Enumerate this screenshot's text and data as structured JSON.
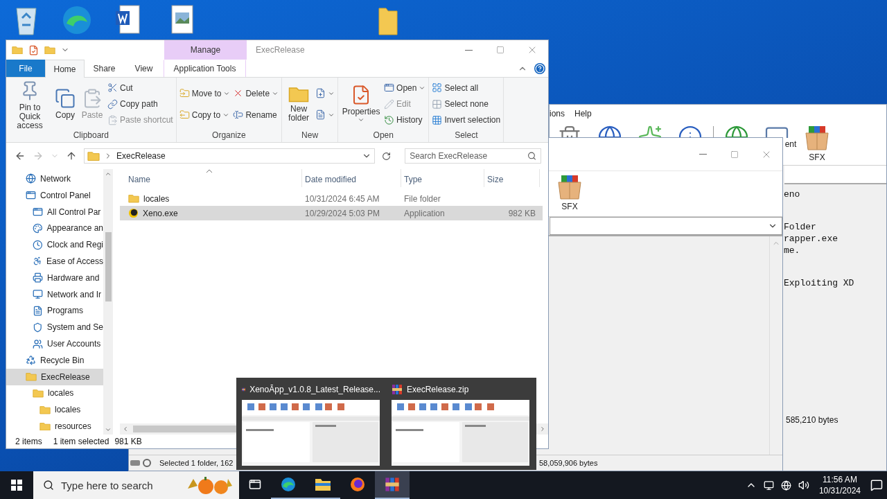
{
  "back_archiver": {
    "menu": [
      "ions",
      "Help"
    ],
    "toolbar_labels": [
      "ent",
      "SFX"
    ],
    "info_paragraphs": [
      [
        "eno"
      ],
      [
        "Folder",
        "rapper.exe",
        "me."
      ],
      [
        "Exploiting XD"
      ]
    ],
    "status": "585,210 bytes"
  },
  "front_archiver": {
    "toolbar_labels": [
      "SFX"
    ],
    "status_left": "Selected 1 folder, 162",
    "status_right": "58,059,906 bytes"
  },
  "explorer": {
    "title": "ExecRelease",
    "context_header": "Manage",
    "tabs": [
      {
        "label": "File",
        "kind": "file",
        "selected": false
      },
      {
        "label": "Home",
        "kind": "tab",
        "selected": true
      },
      {
        "label": "Share",
        "kind": "tab",
        "selected": false
      },
      {
        "label": "View",
        "kind": "tab",
        "selected": false
      },
      {
        "label": "Application Tools",
        "kind": "context",
        "selected": false
      }
    ],
    "ribbon": [
      {
        "name": "Clipboard",
        "columns": [
          [
            {
              "label": "Pin to Quick access",
              "kind": "large",
              "disabled": false
            }
          ],
          [
            {
              "label": "Copy",
              "kind": "large",
              "disabled": false
            }
          ],
          [
            {
              "label": "Paste",
              "kind": "large",
              "disabled": true
            }
          ],
          [
            {
              "label": "Cut",
              "kind": "small",
              "disabled": false
            },
            {
              "label": "Copy path",
              "kind": "small",
              "disabled": false
            },
            {
              "label": "Paste shortcut",
              "kind": "small",
              "disabled": true
            }
          ]
        ]
      },
      {
        "name": "Organize",
        "columns": [
          [
            {
              "label": "Move to",
              "kind": "small",
              "disabled": false,
              "menu": true
            },
            {
              "label": "Copy to",
              "kind": "small",
              "disabled": false,
              "menu": true
            }
          ],
          [
            {
              "label": "Delete",
              "kind": "small",
              "disabled": false,
              "menu": true
            },
            {
              "label": "Rename",
              "kind": "small",
              "disabled": false
            }
          ]
        ]
      },
      {
        "name": "New",
        "columns": [
          [
            {
              "label": "New folder",
              "kind": "large",
              "disabled": false
            }
          ],
          [
            {
              "kind": "icon",
              "disabled": false,
              "menu": true
            },
            {
              "kind": "icon",
              "disabled": false,
              "menu": true
            }
          ]
        ]
      },
      {
        "name": "Open",
        "columns": [
          [
            {
              "label": "Properties",
              "kind": "large",
              "disabled": false,
              "menu": true
            }
          ],
          [
            {
              "label": "Open",
              "kind": "small",
              "disabled": false,
              "menu": true
            },
            {
              "label": "Edit",
              "kind": "small",
              "disabled": true
            },
            {
              "label": "History",
              "kind": "small",
              "disabled": false
            }
          ]
        ]
      },
      {
        "name": "Select",
        "columns": [
          [
            {
              "label": "Select all",
              "kind": "small",
              "disabled": false
            },
            {
              "label": "Select none",
              "kind": "small",
              "disabled": false
            },
            {
              "label": "Invert selection",
              "kind": "small",
              "disabled": false
            }
          ]
        ]
      }
    ],
    "address": {
      "path": "ExecRelease",
      "search_placeholder": "Search ExecRelease"
    },
    "nav": [
      {
        "label": "Network",
        "kind": "network",
        "selected": false
      },
      {
        "label": "Control Panel",
        "kind": "panel",
        "selected": false,
        "children": [
          {
            "label": "All Control Par",
            "kind": "panel",
            "selected": false
          },
          {
            "label": "Appearance an",
            "kind": "appearance",
            "selected": false
          },
          {
            "label": "Clock and Regi",
            "kind": "clock",
            "selected": false
          },
          {
            "label": "Ease of Access",
            "kind": "access",
            "selected": false
          },
          {
            "label": "Hardware and",
            "kind": "hardware",
            "selected": false
          },
          {
            "label": "Network and Ir",
            "kind": "netshare",
            "selected": false
          },
          {
            "label": "Programs",
            "kind": "programs",
            "selected": false
          },
          {
            "label": "System and Se",
            "kind": "security",
            "selected": false
          },
          {
            "label": "User Accounts",
            "kind": "users",
            "selected": false
          }
        ]
      },
      {
        "label": "Recycle Bin",
        "kind": "recycle",
        "selected": false
      },
      {
        "label": "ExecRelease",
        "kind": "folder",
        "selected": true,
        "children": [
          {
            "label": "locales",
            "kind": "folder",
            "selected": false,
            "children": [
              {
                "label": "locales",
                "kind": "folder",
                "selected": false
              },
              {
                "label": "resources",
                "kind": "folder",
                "selected": false
              }
            ]
          }
        ]
      }
    ],
    "columns": [
      {
        "label": "Name",
        "sorted": true
      },
      {
        "label": "Date modified",
        "sorted": false
      },
      {
        "label": "Type",
        "sorted": false
      },
      {
        "label": "Size",
        "sorted": false
      }
    ],
    "rows": [
      {
        "name": "locales",
        "kind": "folder",
        "date": "10/31/2024 6:45 AM",
        "type": "File folder",
        "selected": false
      },
      {
        "name": "Xeno.exe",
        "kind": "app",
        "date": "10/29/2024 5:03 PM",
        "type": "Application",
        "size": "982 KB",
        "selected": true
      }
    ],
    "status": {
      "count": "2 items",
      "selection": "1 item selected",
      "size": "981 KB"
    }
  },
  "thumbnails": [
    {
      "title": "XenoĀpp_v1.0.8_Latest_Release..."
    },
    {
      "title": "ExecRelease.zip"
    }
  ],
  "taskbar": {
    "search_placeholder": "Type here to search",
    "apps": [
      {
        "kind": "edge",
        "running": true,
        "selected": false
      },
      {
        "kind": "explorer",
        "running": true,
        "selected": false
      },
      {
        "kind": "firefox",
        "running": false,
        "selected": false
      },
      {
        "kind": "archiver",
        "running": true,
        "selected": true
      }
    ],
    "time": "11:56 AM",
    "date": "10/31/2024"
  }
}
